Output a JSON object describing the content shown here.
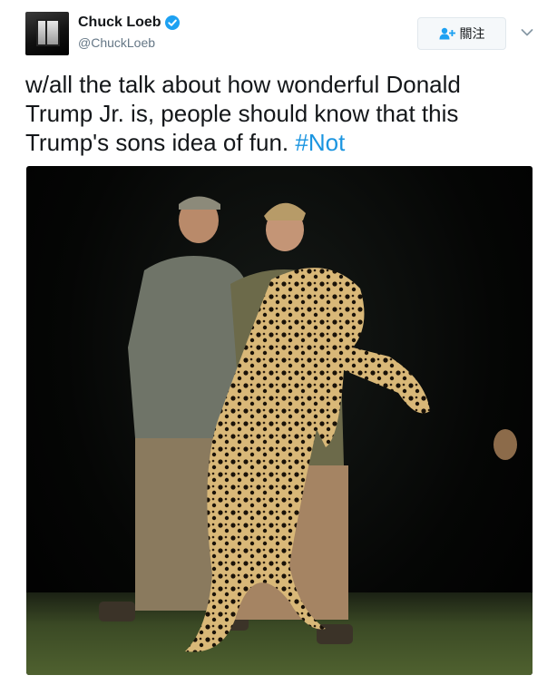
{
  "user": {
    "display_name": "Chuck Loeb",
    "handle": "@ChuckLoeb",
    "verified": true,
    "avatar_icon": "avatar-window-photo"
  },
  "follow_button": {
    "label": "關注",
    "icon": "add-user-icon"
  },
  "menu_icon": "chevron-down-icon",
  "tweet": {
    "text_before": "w/all the talk about how wonderful Donald Trump Jr. is, people should know that this Trump's sons idea of fun. ",
    "hashtag": "#Not"
  },
  "media": {
    "type": "photo"
  },
  "colors": {
    "accent": "#1da1f2",
    "hashtag": "#1b95e0",
    "text": "#14171a",
    "muted": "#657786"
  }
}
